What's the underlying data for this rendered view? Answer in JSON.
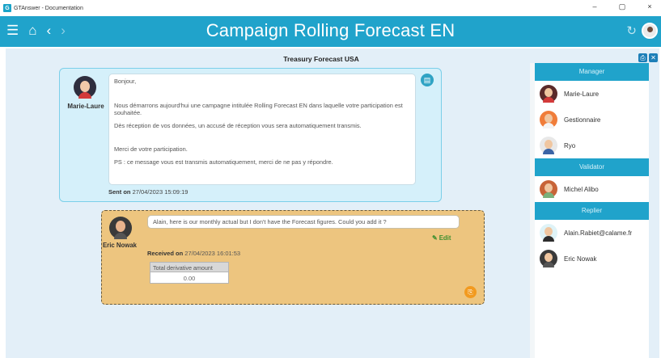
{
  "window": {
    "title": "GTAnswer - Documentation",
    "controls": [
      "–",
      "▢",
      "×"
    ]
  },
  "header": {
    "title": "Campaign Rolling Forecast EN"
  },
  "panel": {
    "title": "Treasury Forecast USA"
  },
  "message1": {
    "sender": "Marie-Laure",
    "paragraphs": [
      "Bonjour,",
      "Nous démarrons aujourd'hui une campagne intitulée Rolling Forecast EN dans laquelle votre participation est souhaitée.",
      "Dès réception de vos données, un accusé de réception vous sera automatiquement transmis.",
      "Merci de votre participation.",
      "PS : ce message vous est transmis automatiquement, merci de ne pas y répondre."
    ],
    "sent_label": "Sent on",
    "sent_date": "27/04/2023 15:09:19"
  },
  "message2": {
    "sender": "Eric Nowak",
    "text": "Alain, here is our monthly actual but I don't have the Forecast figures. Could you add it ?",
    "edit_label": "Edit",
    "received_label": "Received on",
    "received_date": "27/04/2023 16:01:53",
    "field_label": "Total derivative amount",
    "field_value": "0.00"
  },
  "sidebar": {
    "manager_label": "Manager",
    "managers": [
      "Marie-Laure",
      "Gestionnaire",
      "Ryo"
    ],
    "validator_label": "Validator",
    "validators": [
      "Michel Alibo"
    ],
    "replier_label": "Replier",
    "repliers": [
      "Alain.Rabiet@calame.fr",
      "Eric Nowak"
    ]
  }
}
